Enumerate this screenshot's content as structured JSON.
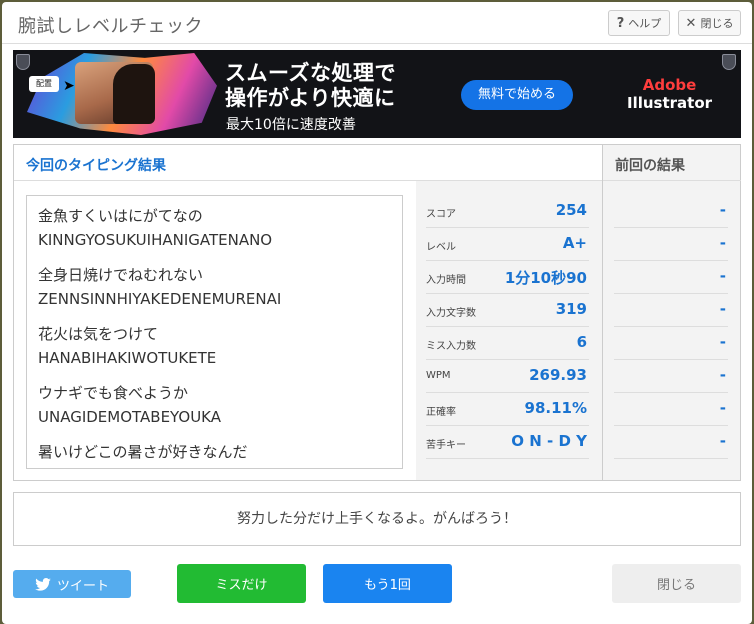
{
  "window": {
    "title": "腕試しレベルチェック",
    "help_label": "ヘルプ",
    "close_label": "閉じる"
  },
  "ad": {
    "tag": "配置",
    "headline_line1": "スムーズな処理で",
    "headline_line2": "操作がより快適に",
    "subline": "最大10倍に速度改善",
    "cta": "無料で始める",
    "brand_line1": "Adobe",
    "brand_line2": "Illustrator"
  },
  "results": {
    "title": "今回のタイピング結果",
    "prev_title": "前回の結果",
    "sentences": [
      {
        "jp": "金魚すくいはにがてなの",
        "romaji": "KINNGYOSUKUIHANIGATENANO"
      },
      {
        "jp": "全身日焼けでねむれない",
        "romaji": "ZENNSINNHIYAKEDENEMURENAI"
      },
      {
        "jp": "花火は気をつけて",
        "romaji": "HANABIHAKIWOTUKETE"
      },
      {
        "jp": "ウナギでも食べようか",
        "romaji": "UNAGIDEMOTABEYOUKA"
      },
      {
        "jp": "暑いけどこの暑さが好きなんだ",
        "romaji": ""
      }
    ],
    "stats": [
      {
        "label": "スコア",
        "value": "254",
        "prev": "-"
      },
      {
        "label": "レベル",
        "value": "A+",
        "prev": "-"
      },
      {
        "label": "入力時間",
        "value": "1分10秒90",
        "prev": "-"
      },
      {
        "label": "入力文字数",
        "value": "319",
        "prev": "-"
      },
      {
        "label": "ミス入力数",
        "value": "6",
        "prev": "-"
      },
      {
        "label": "WPM",
        "value": "269.93",
        "prev": "-"
      },
      {
        "label": "正確率",
        "value": "98.11%",
        "prev": "-"
      },
      {
        "label": "苦手キー",
        "value": "O N - D Y",
        "prev": "-"
      }
    ]
  },
  "message": "努力した分だけ上手くなるよ。がんばろう！",
  "buttons": {
    "tweet": "ツイート",
    "miss_only": "ミスだけ",
    "retry": "もう1回",
    "close": "閉じる"
  },
  "colors": {
    "accent": "#1a73d0",
    "tweet": "#55acee",
    "miss": "#22bb33",
    "retry": "#1a84f0"
  }
}
